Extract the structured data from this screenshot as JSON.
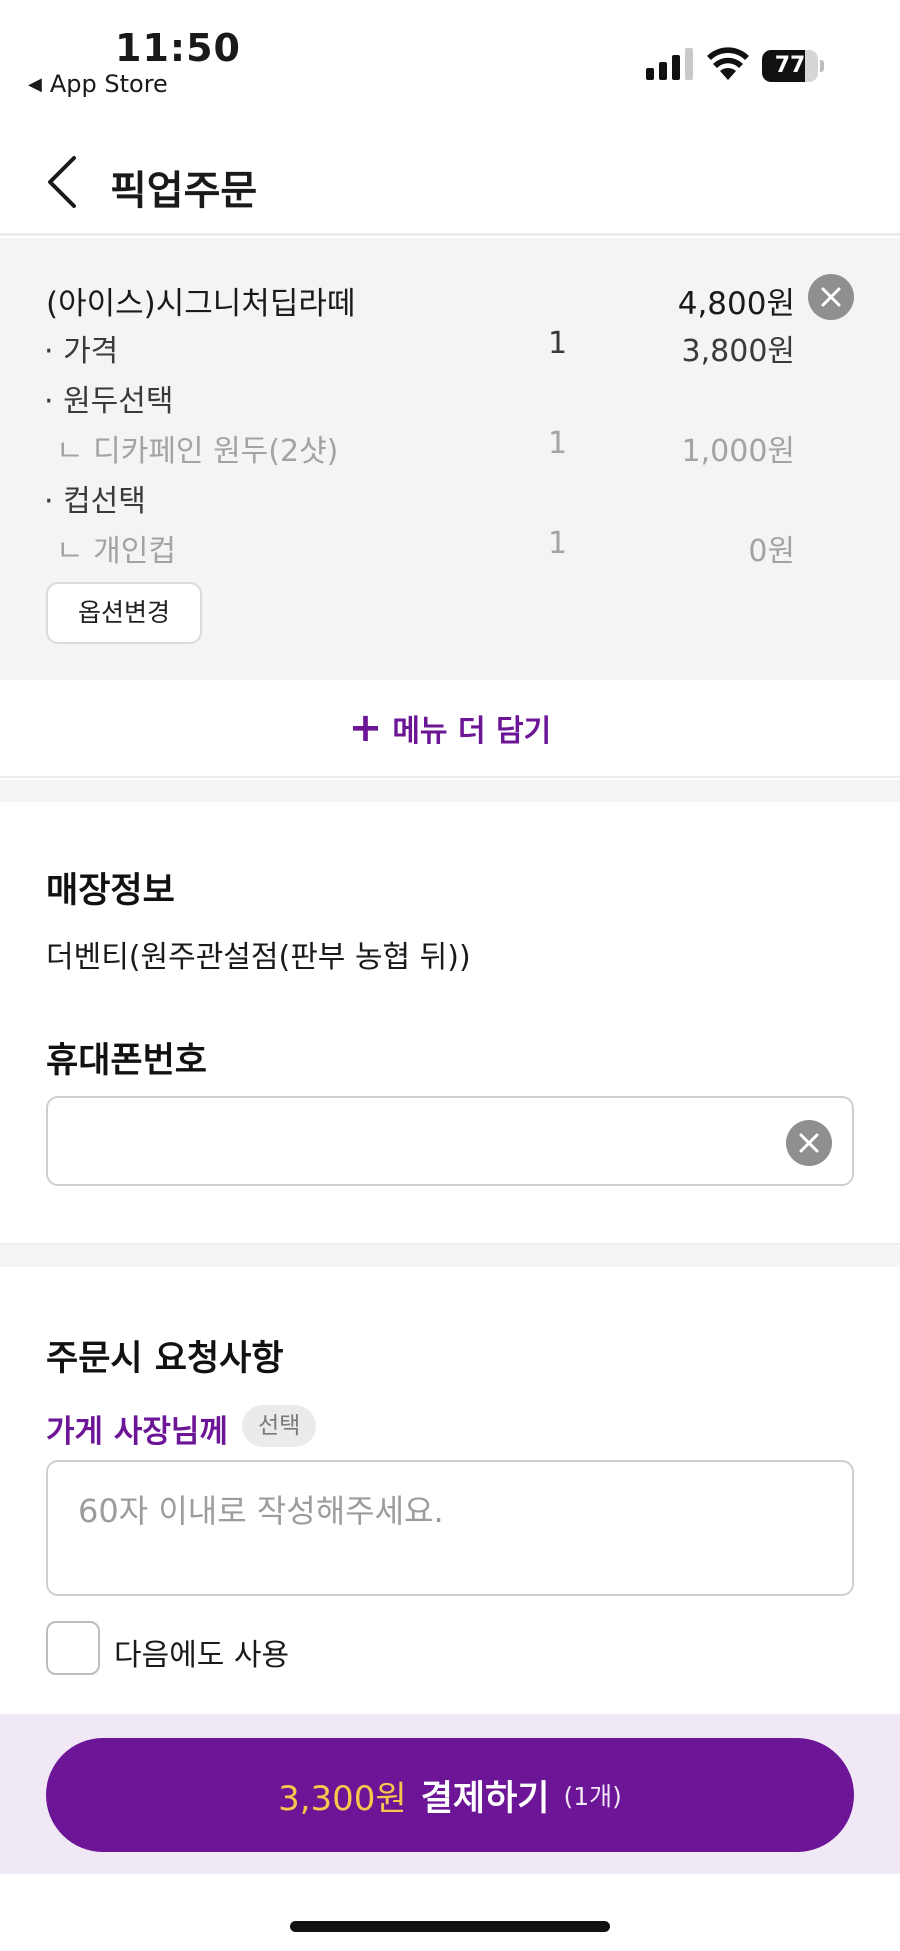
{
  "status_bar": {
    "time": "11:50",
    "back_app": "App Store",
    "battery": "77",
    "battery_level": 0.77
  },
  "header": {
    "title": "픽업주문"
  },
  "cart_item": {
    "name": "(아이스)시그니처딥라떼",
    "total": "4,800원",
    "options": [
      {
        "label": "· 가격",
        "qty": "1",
        "price": "3,800원",
        "style": "dark"
      },
      {
        "label": "· 원두선택",
        "qty": "",
        "price": "",
        "style": "dark"
      },
      {
        "label": "ㄴ 디카페인 원두(2샷)",
        "qty": "1",
        "price": "1,000원",
        "style": "grey"
      },
      {
        "label": "· 컵선택",
        "qty": "",
        "price": "",
        "style": "dark"
      },
      {
        "label": "ㄴ 개인컵",
        "qty": "1",
        "price": "0원",
        "style": "grey"
      }
    ],
    "option_change_label": "옵션변경"
  },
  "add_more": {
    "plus": "+",
    "label": "메뉴 더 담기"
  },
  "store_info": {
    "title": "매장정보",
    "name": "더벤티(원주관설점(판부 농협 뒤))"
  },
  "phone": {
    "title": "휴대폰번호",
    "value": ""
  },
  "request": {
    "title": "주문시 요청사항",
    "owner_label": "가게 사장님께",
    "badge": "선택",
    "placeholder": "60자 이내로 작성해주세요.",
    "reuse_label": "다음에도 사용"
  },
  "payment": {
    "price": "3,300원",
    "label": "결제하기",
    "count": "(1개)"
  },
  "colors": {
    "brand_purple": "#6c1596",
    "price_yellow": "#f6c64d",
    "pay_area_bg": "#f1e8f6"
  }
}
